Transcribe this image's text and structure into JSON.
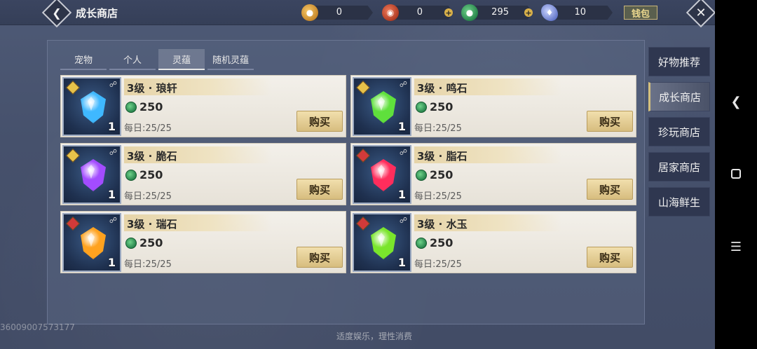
{
  "topbar": {
    "title": "成长商店",
    "currencies": [
      {
        "icon": "gold-coin-icon",
        "value": "0",
        "color": "#d9a23a",
        "has_plus": false
      },
      {
        "icon": "red-token-icon",
        "value": "0",
        "color": "#c8452b",
        "has_plus": true
      },
      {
        "icon": "jade-coin-icon",
        "value": "295",
        "color": "#2f9a58",
        "has_plus": true
      },
      {
        "icon": "crystal-icon",
        "value": "10",
        "color": "#8aa0e8",
        "has_plus": false
      }
    ],
    "wallet_label": "钱包"
  },
  "tabs": [
    {
      "label": "宠物",
      "active": false
    },
    {
      "label": "个人",
      "active": false
    },
    {
      "label": "灵蕴",
      "active": true
    },
    {
      "label": "随机灵蕴",
      "active": false
    }
  ],
  "items": [
    {
      "name": "3级 · 琅轩",
      "price": "250",
      "daily": "每日:25/25",
      "qty": "1",
      "buy": "购买",
      "gem_color": "#3fb8ff",
      "badge_color": "#e7c24a"
    },
    {
      "name": "3级 · 鸣石",
      "price": "250",
      "daily": "每日:25/25",
      "qty": "1",
      "buy": "购买",
      "gem_color": "#5fe03c",
      "badge_color": "#e7c24a"
    },
    {
      "name": "3级 · 脆石",
      "price": "250",
      "daily": "每日:25/25",
      "qty": "1",
      "buy": "购买",
      "gem_color": "#a34cff",
      "badge_color": "#e7c24a"
    },
    {
      "name": "3级 · 脂石",
      "price": "250",
      "daily": "每日:25/25",
      "qty": "1",
      "buy": "购买",
      "gem_color": "#ff2d5c",
      "badge_color": "#d23a3a"
    },
    {
      "name": "3级 · 瑞石",
      "price": "250",
      "daily": "每日:25/25",
      "qty": "1",
      "buy": "购买",
      "gem_color": "#ffa21f",
      "badge_color": "#d23a3a"
    },
    {
      "name": "3级 · 水玉",
      "price": "250",
      "daily": "每日:25/25",
      "qty": "1",
      "buy": "购买",
      "gem_color": "#7ae52c",
      "badge_color": "#d23a3a"
    }
  ],
  "side_nav": [
    {
      "label": "好物推荐",
      "active": false
    },
    {
      "label": "成长商店",
      "active": true
    },
    {
      "label": "珍玩商店",
      "active": false
    },
    {
      "label": "居家商店",
      "active": false
    },
    {
      "label": "山海鲜生",
      "active": false
    }
  ],
  "watermark": "36009007573177",
  "footer_note": "适度娱乐，理性消费"
}
